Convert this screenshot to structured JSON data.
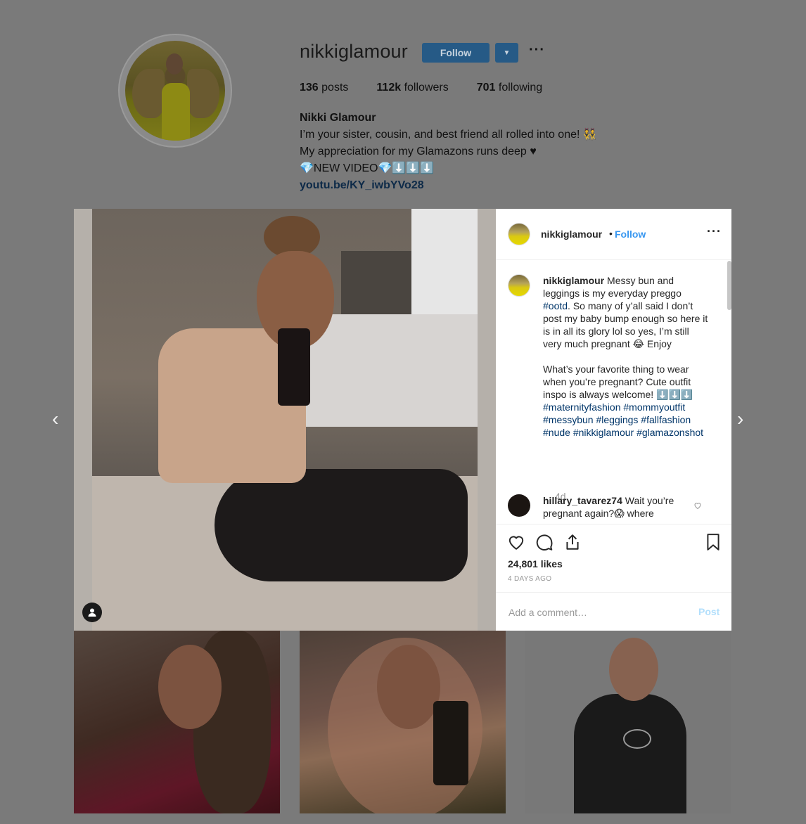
{
  "profile": {
    "username": "nikkiglamour",
    "follow_label": "Follow",
    "more_label": "···",
    "stats": {
      "posts_count": "136",
      "posts_label": "posts",
      "followers_count": "112k",
      "followers_label": "followers",
      "following_count": "701",
      "following_label": "following"
    },
    "bio": {
      "name": "Nikki Glamour",
      "line1": "I’m your sister, cousin, and best friend all rolled into one! 👯",
      "line2": "My appreciation for my Glamazons runs deep ♥",
      "line3": "💎NEW VIDEO💎⬇️⬇️⬇️",
      "link": "youtu.be/KY_iwbYVo28"
    }
  },
  "post": {
    "header": {
      "username": "nikkiglamour",
      "dot": "•",
      "follow_label": "Follow",
      "more_label": "···"
    },
    "caption": {
      "username": "nikkiglamour",
      "text_part1": " Messy bun and leggings is my everyday preggo ",
      "tag_ootd": "#ootd",
      "text_part2": ". So many of y’all said I don’t post my baby bump enough so here it is in all its glory lol so yes, I’m still very much pregnant 😂 Enjoy",
      "text_part3": "What’s your favorite thing to wear when you’re pregnant? Cute outfit inspo is always welcome! ⬇️⬇️⬇️",
      "hashtags": "#maternityfashion #mommyoutfit #messybun #leggings #fallfashion #nude #nikkiglamour #glamazonshot",
      "time": "4d"
    },
    "comment": {
      "username": "hillary_tavarez74",
      "text": " Wait you’re pregnant again?😱 where"
    },
    "likes": "24,801 likes",
    "time_ago": "4 DAYS AGO",
    "comment_placeholder": "Add a comment…",
    "post_label": "Post"
  },
  "icons": {
    "nav_left": "‹",
    "nav_right": "›",
    "user_tag": "👤"
  }
}
